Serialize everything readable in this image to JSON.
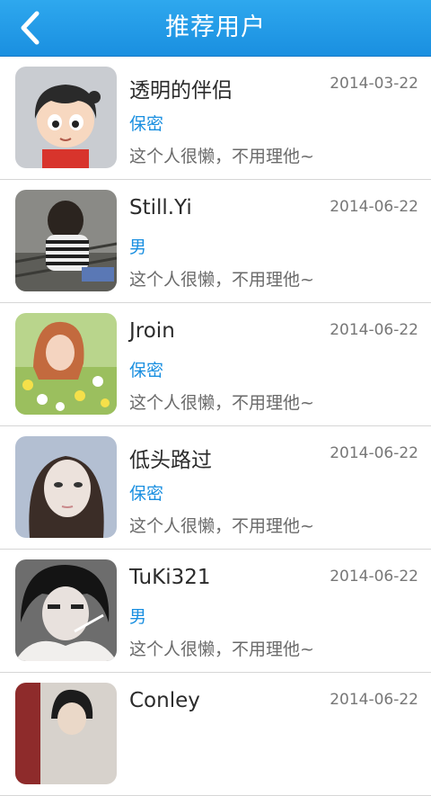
{
  "header": {
    "title": "推荐用户",
    "back_icon": "chevron-left-icon"
  },
  "colors": {
    "header": "#1a8fe0",
    "gender_text": "#1a8fe0"
  },
  "users": [
    {
      "name": "透明的伴侣",
      "date": "2014-03-22",
      "gender": "保密",
      "signature": "这个人很懒，不用理他~"
    },
    {
      "name": "Still.Yi",
      "date": "2014-06-22",
      "gender": "男",
      "signature": "这个人很懒，不用理他~"
    },
    {
      "name": "Jroin",
      "date": "2014-06-22",
      "gender": "保密",
      "signature": "这个人很懒，不用理他~"
    },
    {
      "name": "低头路过",
      "date": "2014-06-22",
      "gender": "保密",
      "signature": "这个人很懒，不用理他~"
    },
    {
      "name": "TuKi321",
      "date": "2014-06-22",
      "gender": "男",
      "signature": "这个人很懒，不用理他~"
    },
    {
      "name": "Conley",
      "date": "2014-06-22",
      "gender": "",
      "signature": ""
    }
  ]
}
